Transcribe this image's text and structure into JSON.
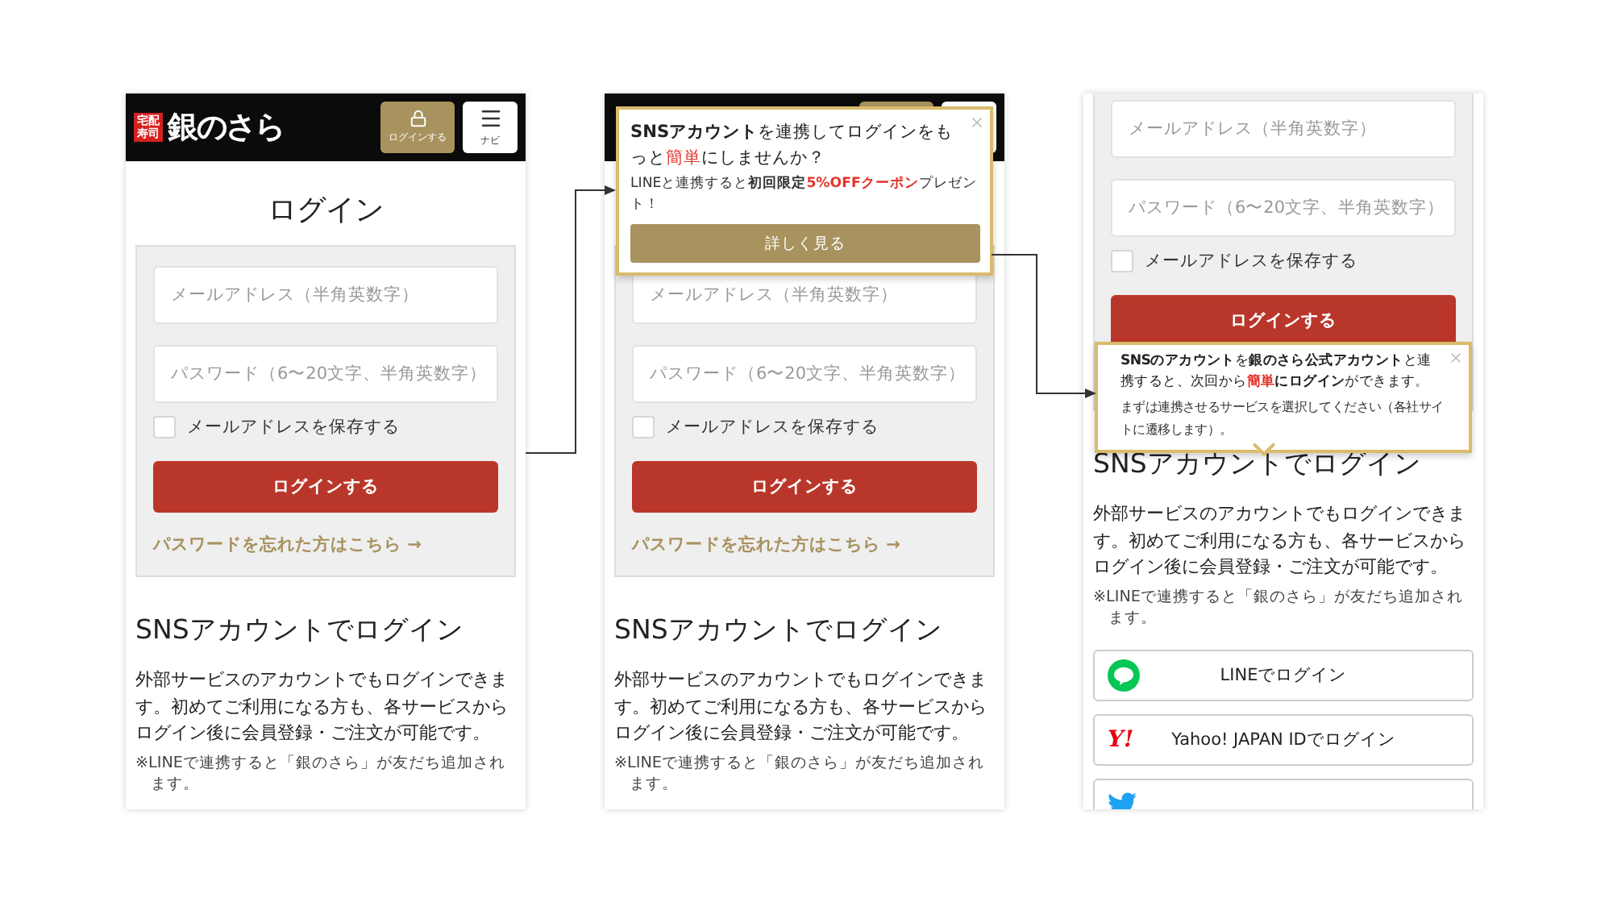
{
  "screens": [
    {
      "header": {
        "kind": "full",
        "logo_badge": "宅配寿司",
        "logo": "銀のさら",
        "login_button": "ログインする",
        "nav_button": "ナビ"
      },
      "title": "ログイン",
      "form": {
        "email_placeholder": "メールアドレス（半角英数字）",
        "password_placeholder": "パスワード（6〜20文字、半角英数字）",
        "remember": {
          "label": "メールアドレスを保存する",
          "checked": false
        },
        "submit": "ログインする",
        "forgot_link": "パスワードを忘れた方はこちら →"
      },
      "sns": {
        "heading": "SNSアカウントでログイン",
        "description": "外部サービスのアカウントでもログインできます。初めてご利用になる方も、各サービスからログイン後に会員登録・ご注文が可能です。",
        "note": "※LINEで連携すると「銀のさら」が友だち追加されます。"
      }
    },
    {
      "header": {
        "kind": "covered"
      },
      "form": {
        "email_placeholder": "メールアドレス（半角英数字）",
        "password_placeholder": "パスワード（6〜20文字、半角英数字）",
        "remember": {
          "label": "メールアドレスを保存する",
          "checked": false
        },
        "submit": "ログインする",
        "forgot_link": "パスワードを忘れた方はこちら →"
      },
      "popup": {
        "kind": "banner",
        "message": [
          {
            "text": "SNSアカウント",
            "kind": "bold"
          },
          {
            "text": "を連携してログインをもっと",
            "kind": "plain"
          },
          {
            "text": "簡単",
            "kind": "accent"
          },
          {
            "text": "にしませんか？",
            "kind": "plain"
          }
        ],
        "detail": [
          {
            "text": "LINEと連携すると",
            "kind": "plain"
          },
          {
            "text": "初回限定",
            "kind": "bold"
          },
          {
            "text": "5%OFFクーポン",
            "kind": "accent-bold"
          },
          {
            "text": "プレゼント！",
            "kind": "plain"
          }
        ],
        "button": "詳しく見る"
      },
      "sns": {
        "heading": "SNSアカウントでログイン",
        "description": "外部サービスのアカウントでもログインできます。初めてご利用になる方も、各サービスからログイン後に会員登録・ご注文が可能です。",
        "note": "※LINEで連携すると「銀のさら」が友だち追加されます。"
      }
    },
    {
      "form": {
        "email_placeholder": "メールアドレス（半角英数字）",
        "password_placeholder": "パスワード（6〜20文字、半角英数字）",
        "remember": {
          "label": "メールアドレスを保存する",
          "checked": false
        },
        "submit": "ログインする"
      },
      "popup": {
        "kind": "tooltip",
        "message": [
          {
            "text": "SNSのアカウント",
            "kind": "bold"
          },
          {
            "text": "を",
            "kind": "plain"
          },
          {
            "text": "銀のさら公式アカウント",
            "kind": "bold"
          },
          {
            "text": "と連携すると、次回から",
            "kind": "plain"
          },
          {
            "text": "簡単",
            "kind": "accent-bold"
          },
          {
            "text": "にログイン",
            "kind": "bold"
          },
          {
            "text": "ができます。",
            "kind": "plain"
          }
        ],
        "detail": [
          {
            "text": "まずは連携させるサービスを選択してください（各社サイトに遷移します）。",
            "kind": "plain"
          }
        ]
      },
      "sns": {
        "heading": "SNSアカウントでログイン",
        "description": "外部サービスのアカウントでもログインできます。初めてご利用になる方も、各サービスからログイン後に会員登録・ご注文が可能です。",
        "note": "※LINEで連携すると「銀のさら」が友だち追加されます。",
        "providers": [
          {
            "kind": "line",
            "label": "LINEでログイン"
          },
          {
            "kind": "yahoo",
            "logo_text": "Y!",
            "label": "Yahoo! JAPAN IDでログイン"
          },
          {
            "kind": "twitter"
          }
        ]
      }
    }
  ]
}
